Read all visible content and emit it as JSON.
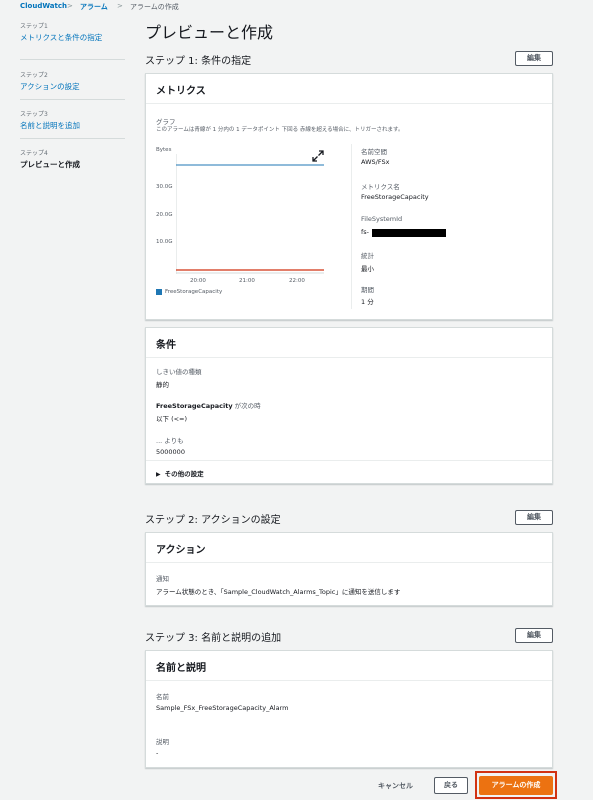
{
  "breadcrumb": [
    "CloudWatch",
    "アラーム",
    "アラームの作成"
  ],
  "wizard_steps": [
    {
      "step": "ステップ1",
      "label": "メトリクスと条件の指定"
    },
    {
      "step": "ステップ2",
      "label": "アクションの設定"
    },
    {
      "step": "ステップ3",
      "label": "名前と説明を追加"
    },
    {
      "step": "ステップ4",
      "label": "プレビューと作成"
    }
  ],
  "page_title": "プレビューと作成",
  "edit_label": "編集",
  "step1": {
    "title": "ステップ 1: 条件の指定",
    "metrics_panel_title": "メトリクス",
    "graph_label": "グラフ",
    "graph_desc": "このアラームは青線が 1 分内の 1 データポイント 下回る 赤線を超える場合に、トリガーされます。",
    "graph": {
      "unit": "Bytes",
      "y_ticks": [
        "30.0G",
        "20.0G",
        "10.0G"
      ],
      "x_ticks": [
        "20:00",
        "21:00",
        "22:00"
      ],
      "legend": "FreeStorageCapacity",
      "series_color": "#1f77b4",
      "threshold_color": "#d13212",
      "expand_icon": "expand-icon"
    },
    "details": [
      {
        "key": "名前空間",
        "value": "AWS/FSx"
      },
      {
        "key": "メトリクス名",
        "value": "FreeStorageCapacity"
      },
      {
        "key": "FileSystemId",
        "value": "fs-"
      },
      {
        "key": "統計",
        "value": "最小"
      },
      {
        "key": "期間",
        "value": "1 分"
      }
    ],
    "conditions_panel_title": "条件",
    "threshold_type_label": "しきい値の種類",
    "threshold_type_value": "静的",
    "when_label_bold": "FreeStorageCapacity",
    "when_label_rest": " が次の時",
    "when_value": "以下 (<=)",
    "than_label": "... よりも",
    "than_value": "5000000",
    "other_settings": "その他の設定"
  },
  "step2": {
    "title": "ステップ 2: アクションの設定",
    "panel_title": "アクション",
    "notification_label": "通知",
    "notification_text": "アラーム状態のとき、「Sample_CloudWatch_Alarms_Topic」に通知を送信します"
  },
  "step3": {
    "title": "ステップ 3: 名前と説明の追加",
    "panel_title": "名前と説明",
    "name_label": "名前",
    "name_value": "Sample_FSx_FreeStorageCapacity_Alarm",
    "desc_label": "説明",
    "desc_value": "-"
  },
  "footer": {
    "cancel": "キャンセル",
    "back": "戻る",
    "create": "アラームの作成"
  },
  "colors": {
    "accent": "#ec7211",
    "highlight_border": "#d13212",
    "link": "#0073bb"
  }
}
